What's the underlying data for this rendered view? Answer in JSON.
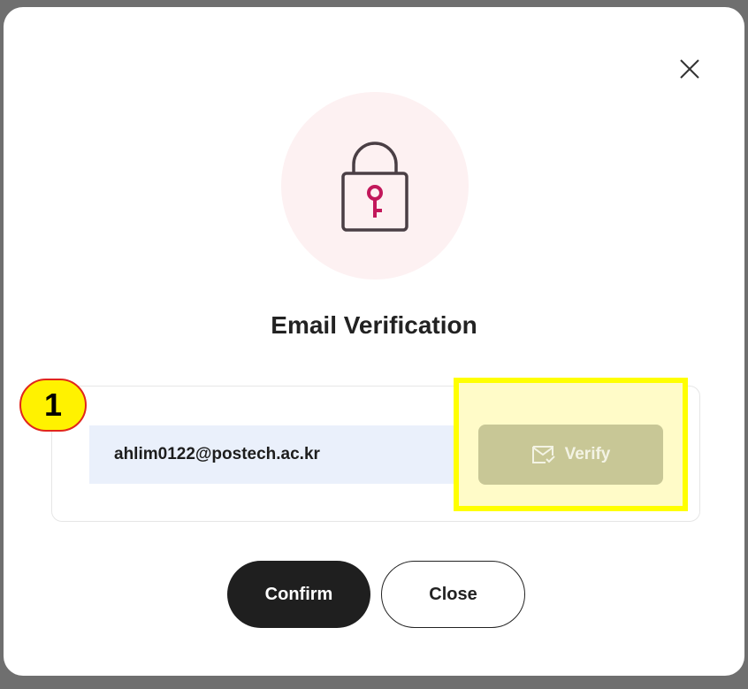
{
  "dialog": {
    "title": "Email Verification",
    "email_value": "ahlim0122@postech.ac.kr",
    "verify_label": "Verify",
    "confirm_label": "Confirm",
    "close_label": "Close",
    "annotation_badge": "1"
  },
  "icons": {
    "close": "close-icon",
    "lock": "lock-key-icon",
    "mail": "mail-check-icon"
  },
  "colors": {
    "accent": "#c2185b",
    "lock_circle_bg": "#fdf1f2",
    "input_bg": "#eaf0fb",
    "verify_disabled_bg": "#c8c796",
    "highlight": "#ffff00",
    "confirm_bg": "#1f1f1f"
  }
}
